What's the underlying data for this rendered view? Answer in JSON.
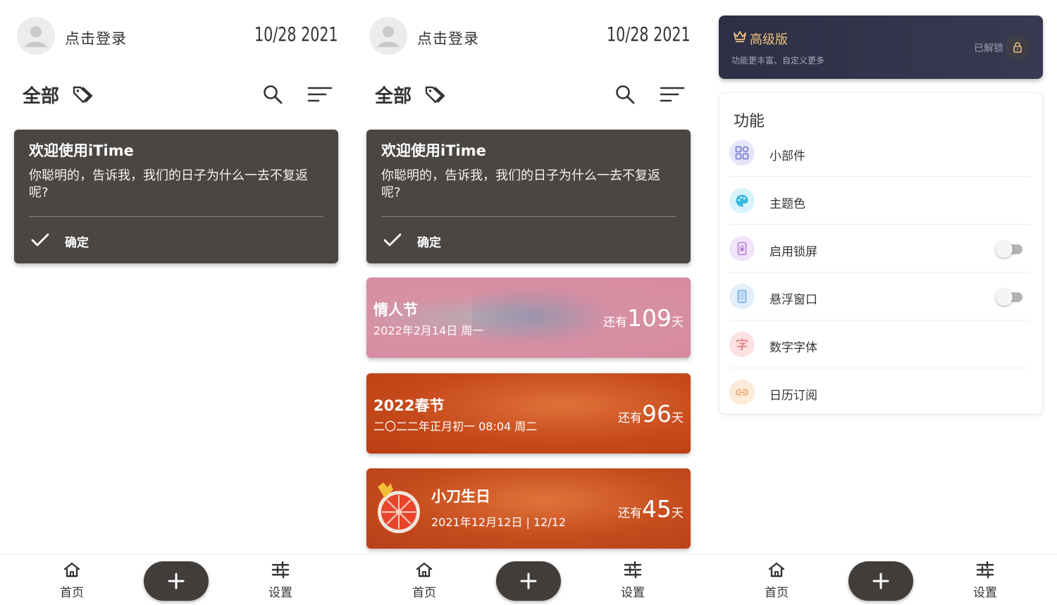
{
  "header": {
    "login_text": "点击登录",
    "date": "10/28 2021"
  },
  "filter": {
    "label": "全部"
  },
  "welcome": {
    "title": "欢迎使用iTime",
    "body": "你聪明的，告诉我，我们的日子为什么一去不复返呢?",
    "confirm": "确定"
  },
  "events": [
    {
      "name": "情人节",
      "date": "2022年2月14日 周一",
      "prefix": "还有",
      "days": "109",
      "suffix": "天",
      "color": "#d68aa0"
    },
    {
      "name": "2022春节",
      "date": "二〇二二年正月初一 08:04 周二",
      "prefix": "还有",
      "days": "96",
      "suffix": "天",
      "color": "#c64a1b"
    },
    {
      "name": "小刀生日",
      "date": "2021年12月12日 | 12/12",
      "prefix": "还有",
      "days": "45",
      "suffix": "天",
      "color": "#c54c1d"
    }
  ],
  "nav": {
    "home": "首页",
    "settings": "设置",
    "add_icon": "plus-icon"
  },
  "premium": {
    "title": "高级版",
    "subtitle": "功能更丰富、自定义更多",
    "status": "已解锁"
  },
  "features": {
    "title": "功能",
    "items": [
      {
        "label": "小部件",
        "icon": "widget-icon",
        "color": "#7b7fd8",
        "bg": "#e6e6fa"
      },
      {
        "label": "主题色",
        "icon": "palette-icon",
        "color": "#35b9e0",
        "bg": "#d8f3fb"
      },
      {
        "label": "启用锁屏",
        "icon": "lock-screen-icon",
        "color": "#b57bd8",
        "bg": "#f1e4fa",
        "toggle": false
      },
      {
        "label": "悬浮窗口",
        "icon": "phone-window-icon",
        "color": "#6aa7e8",
        "bg": "#e3eefb",
        "toggle": false
      },
      {
        "label": "数字字体",
        "icon": "font-icon",
        "color": "#e8727a",
        "bg": "#fde2e3"
      },
      {
        "label": "日历订阅",
        "icon": "link-icon",
        "color": "#e8a56a",
        "bg": "#fdebd9"
      }
    ]
  },
  "colors": {
    "card_dark": "#4a4643",
    "premium_bg": "#2d2f45",
    "premium_gold": "#e8c07a"
  }
}
